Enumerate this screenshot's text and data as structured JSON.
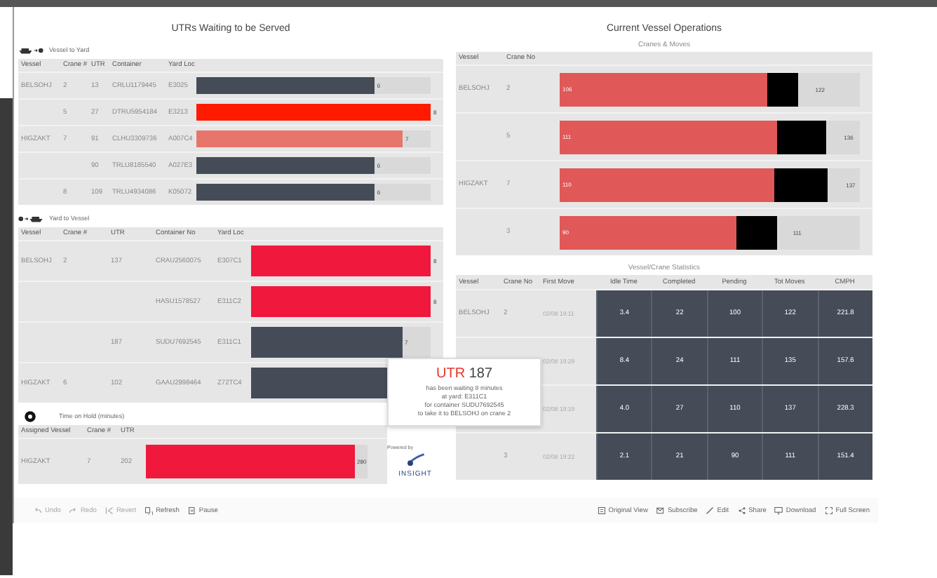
{
  "utrs_waiting": {
    "title": "UTRs Waiting to be Served",
    "vessel_to_yard": {
      "legend": "Vessel to Yard",
      "columns": [
        "Vessel",
        "Crane #",
        "UTR",
        "Container",
        "Yard Loc"
      ],
      "rows": [
        {
          "vessel": "BELSOHJ",
          "crane": "2",
          "utr": "13",
          "container": "CRLU1179445",
          "yard_loc": "E3025",
          "level": 0.76,
          "value": "6",
          "color": "#454c58"
        },
        {
          "crane": "5",
          "utr": "27",
          "container": "DTRU5954184",
          "yard_loc": "E3213",
          "level": 1.0,
          "value": "8",
          "color": "#ff1a00"
        },
        {
          "vessel": "HIGZAKT",
          "crane": "7",
          "utr": "91",
          "container": "CLHU3309736",
          "yard_loc": "A007C4",
          "level": 0.88,
          "value": "7",
          "color": "#e8756c"
        },
        {
          "utr": "90",
          "container": "TRLU8185540",
          "yard_loc": "A027E3",
          "level": 0.76,
          "value": "6",
          "color": "#454c58"
        },
        {
          "crane": "8",
          "utr": "109",
          "container": "TRLU4934086",
          "yard_loc": "K05072",
          "level": 0.76,
          "value": "6",
          "color": "#454c58"
        }
      ]
    },
    "yard_to_vessel": {
      "legend": "Yard to Vessel",
      "columns": [
        "Vessel",
        "Crane #",
        "UTR",
        "Container No",
        "Yard Loc"
      ],
      "rows": [
        {
          "vessel": "BELSOHJ",
          "crane": "2",
          "utr": "137",
          "container": "CRAU2560075",
          "yard_loc": "E307C1",
          "level": 1.0,
          "value": "8",
          "color": "#f0183c"
        },
        {
          "container": "HASU1578527",
          "yard_loc": "E311C2",
          "level": 1.0,
          "value": "8",
          "color": "#f0183c"
        },
        {
          "utr": "187",
          "container": "SUDU7692545",
          "yard_loc": "E311C1",
          "level": 0.84,
          "value": "7",
          "color": "#454c58"
        },
        {
          "vessel": "HIGZAKT",
          "crane": "6",
          "utr": "102",
          "container": "GAAU2998464",
          "yard_loc": "Z72TC4",
          "level": 0.84,
          "color": "#454c58"
        }
      ]
    },
    "time_on_hold": {
      "legend": "Time on Hold (minutes)",
      "columns": [
        "Assigned Vessel",
        "Crane #",
        "UTR"
      ],
      "rows": [
        {
          "vessel": "HIGZAKT",
          "crane": "7",
          "utr": "202",
          "level": 0.94,
          "value": "280",
          "color": "#f0183c"
        }
      ]
    }
  },
  "logo": {
    "caption": "Powered by",
    "name": "INSIGHT"
  },
  "vessel_operations": {
    "title": "Current Vessel Operations",
    "subtitle": "Cranes & Moves",
    "columns": [
      "Vessel",
      "Crane No"
    ],
    "rows": [
      {
        "vessel": "BELSOHJ",
        "crane": "2",
        "completed": "106",
        "total": "122"
      },
      {
        "crane": "5",
        "completed": "111",
        "total": "136"
      },
      {
        "vessel": "HIGZAKT",
        "crane": "7",
        "completed": "110",
        "total": "137"
      },
      {
        "crane": "3",
        "completed": "90",
        "total": "111"
      }
    ]
  },
  "crane_statistics": {
    "title": "Vessel/Crane Statistics",
    "columns": [
      "Vessel",
      "Crane No",
      "First Move",
      "Idle Time",
      "Completed",
      "Pending",
      "Tot Moves",
      "CMPH"
    ],
    "rows": [
      {
        "vessel": "BELSOHJ",
        "crane": "2",
        "first_move": "02/08 19:11",
        "values": [
          "3.4",
          "22",
          "100",
          "122",
          "221.8"
        ]
      },
      {
        "first_move": "02/08 19:29",
        "values": [
          "8.4",
          "24",
          "111",
          "135",
          "157.6"
        ]
      },
      {
        "first_move": "02/08 19:19",
        "values": [
          "4.0",
          "27",
          "110",
          "137",
          "228.3"
        ]
      },
      {
        "crane": "3",
        "first_move": "02/08 19:22",
        "values": [
          "2.1",
          "21",
          "90",
          "111",
          "151.4"
        ]
      }
    ]
  },
  "tooltip": {
    "label": "UTR",
    "number": "187",
    "lines": [
      "has been waiting 8 minutes",
      "at yard: E311C1",
      "for container SUDU7692545",
      "to take it to BELSOHJ on crane 2"
    ]
  },
  "toolbar": {
    "left": [
      {
        "label": "Undo",
        "disabled": true
      },
      {
        "label": "Redo",
        "disabled": true
      },
      {
        "label": "Revert",
        "disabled": true
      },
      {
        "label": "Refresh",
        "disabled": false
      },
      {
        "label": "Pause",
        "disabled": false
      }
    ],
    "right": [
      {
        "label": "Original View",
        "disabled": false
      },
      {
        "label": "Subscribe",
        "disabled": false
      },
      {
        "label": "Edit",
        "disabled": false
      },
      {
        "label": "Share",
        "disabled": false
      },
      {
        "label": "Download",
        "disabled": false
      },
      {
        "label": "Full Screen",
        "disabled": false
      }
    ]
  }
}
